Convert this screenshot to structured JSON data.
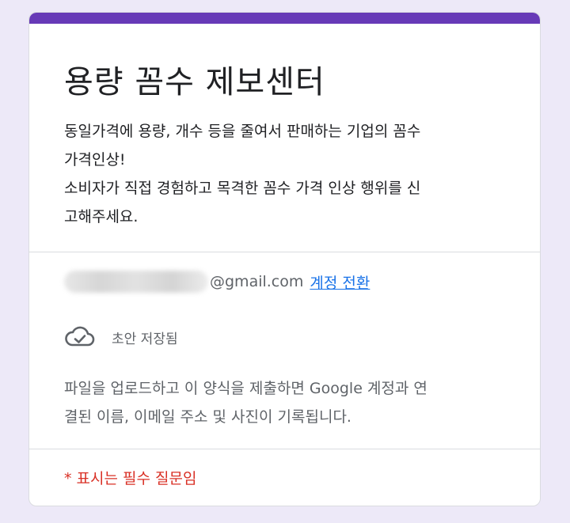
{
  "form": {
    "title": "용량 꼼수 제보센터",
    "description": "동일가격에 용량, 개수 등을 줄여서 판매하는 기업의 꼼수\n가격인상!\n소비자가 직접 경험하고 목격한 꼼수 가격 인상 행위를 신\n고해주세요."
  },
  "account": {
    "email_domain": "@gmail.com",
    "switch_label": "계정 전환"
  },
  "draft": {
    "icon": "cloud-check-icon",
    "status": "초안 저장됨"
  },
  "upload_note": "파일을 업로드하고 이 양식을 제출하면 Google 계정과 연\n결된 이름, 이메일 주소 및 사진이 기록됩니다.",
  "required_note": "* 표시는 필수 질문임",
  "colors": {
    "accent": "#673ab7",
    "link": "#1a73e8",
    "required": "#d93025",
    "background": "#ede9f8"
  }
}
